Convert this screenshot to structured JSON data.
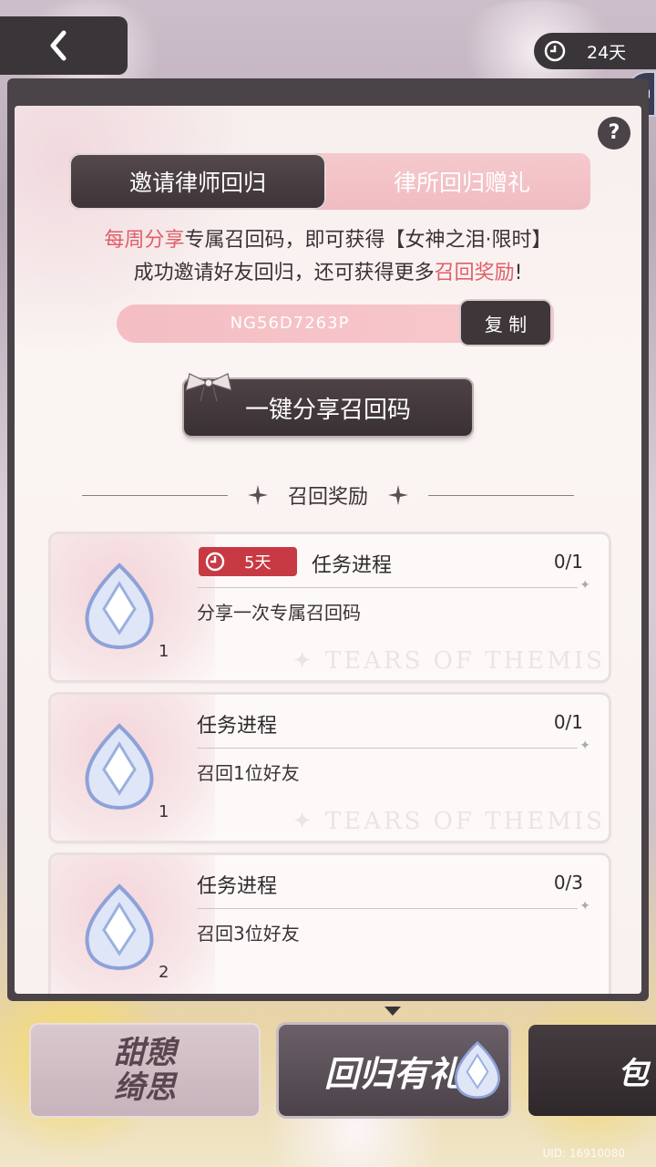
{
  "header": {
    "back_icon": "chevron-left-icon",
    "timer": {
      "icon": "clock-icon",
      "label": "24天"
    }
  },
  "tabs": [
    {
      "label": "邀请律师回归",
      "active": true
    },
    {
      "label": "律所回归赠礼",
      "active": false
    }
  ],
  "description": {
    "line1": {
      "highlight": "每周分享",
      "text": "专属召回码，即可获得【女神之泪·限时】"
    },
    "line2": {
      "text": "成功邀请好友回归，还可获得更多",
      "highlight": "召回奖励",
      "suffix": "!"
    }
  },
  "invite_code": {
    "value": "NG56D7263P",
    "copy_label": "复 制"
  },
  "share_button": {
    "label": "一键分享召回码"
  },
  "section_title": "召回奖励",
  "tasks": [
    {
      "timer": "5天",
      "title": "任务进程",
      "progress": "0/1",
      "desc": "分享一次专属召回码",
      "reward_count": "1"
    },
    {
      "timer": "",
      "title": "任务进程",
      "progress": "0/1",
      "desc": "召回1位好友",
      "reward_count": "1"
    },
    {
      "timer": "",
      "title": "任务进程",
      "progress": "0/3",
      "desc": "召回3位好友",
      "reward_count": "2"
    }
  ],
  "bottom_nav": {
    "item1": {
      "line1": "甜憩",
      "line2": "绮思"
    },
    "item2": {
      "label": "回归有礼"
    },
    "item3": {
      "label": "包"
    }
  },
  "uid": "UID: 16910080",
  "colors": {
    "accent": "#e05e6a",
    "dark": "#3f3639",
    "pink": "#f4bec3",
    "badge_red": "#c73a44"
  }
}
